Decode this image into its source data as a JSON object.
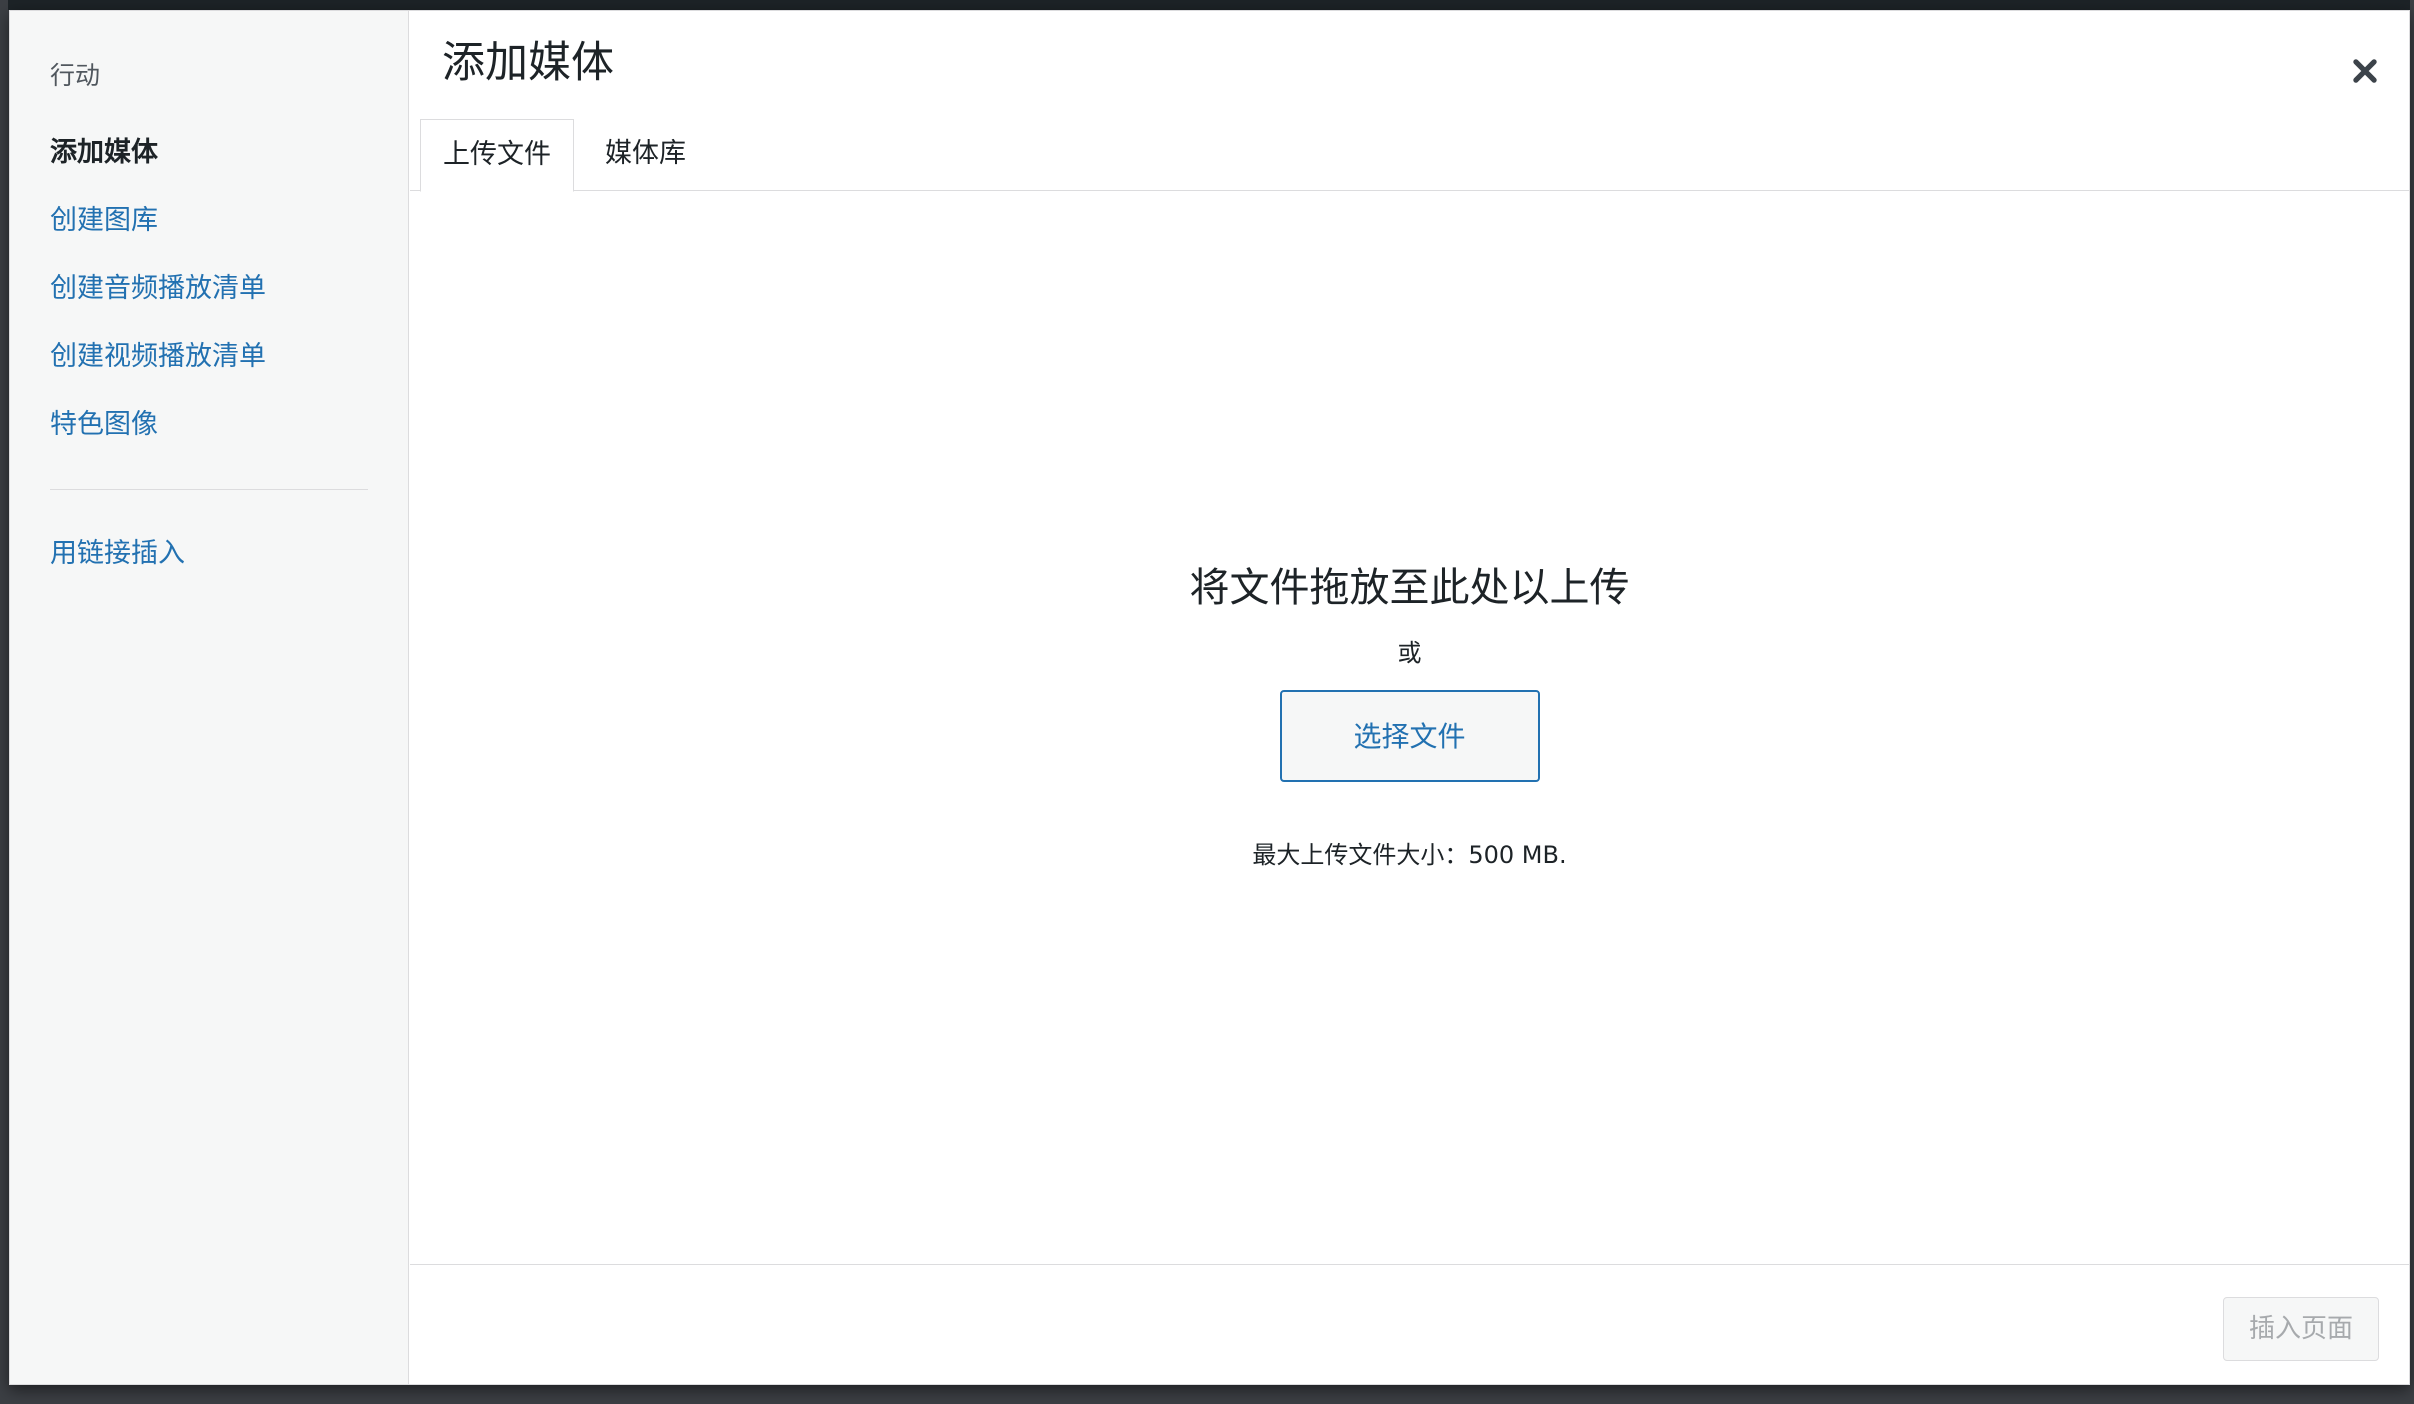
{
  "window": {
    "title": "添加媒体"
  },
  "menu": {
    "heading": "行动",
    "items": [
      {
        "label": "添加媒体",
        "active": true
      },
      {
        "label": "创建图库",
        "active": false
      },
      {
        "label": "创建音频播放清单",
        "active": false
      },
      {
        "label": "创建视频播放清单",
        "active": false
      },
      {
        "label": "特色图像",
        "active": false
      }
    ],
    "extra_items": [
      {
        "label": "用链接插入"
      }
    ]
  },
  "tabs": [
    {
      "label": "上传文件",
      "active": true
    },
    {
      "label": "媒体库",
      "active": false
    }
  ],
  "uploader": {
    "drop_title": "将文件拖放至此处以上传",
    "or": "或",
    "select_button": "选择文件",
    "max_size": "最大上传文件大小：500 MB."
  },
  "toolbar": {
    "insert_button": "插入页面"
  },
  "icons": {
    "close": "close-icon"
  },
  "colors": {
    "accent": "#2271b1",
    "text": "#1d2327",
    "muted": "#a7aaad",
    "menu_bg": "#f6f7f7"
  }
}
